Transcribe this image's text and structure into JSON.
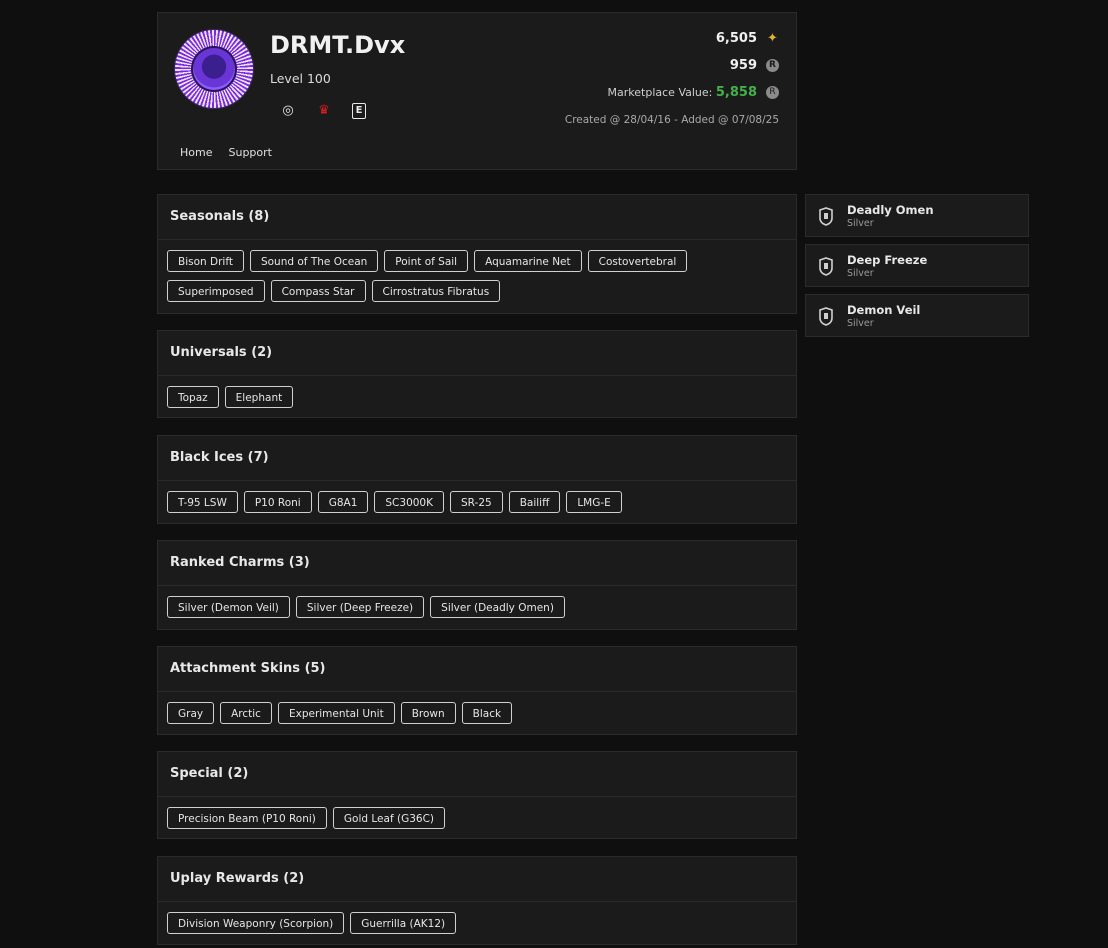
{
  "profile": {
    "name": "DRMT.Dvx",
    "level": "Level 100",
    "renown": "6,505",
    "credits": "959",
    "marketplace_label": "Marketplace Value:",
    "marketplace_value": "5,858",
    "created": "Created @ 28/04/16 - Added @ 07/08/25",
    "platforms": [
      "ubisoft-icon",
      "playstation-icon",
      "epic-icon"
    ]
  },
  "nav": {
    "home": "Home",
    "support": "Support"
  },
  "sections": [
    {
      "title": "Seasonals (8)",
      "items": [
        "Bison Drift",
        "Sound of The Ocean",
        "Point of Sail",
        "Aquamarine Net",
        "Costovertebral",
        "Superimposed",
        "Compass Star",
        "Cirrostratus Fibratus"
      ]
    },
    {
      "title": "Universals (2)",
      "items": [
        "Topaz",
        "Elephant"
      ]
    },
    {
      "title": "Black Ices (7)",
      "items": [
        "T-95 LSW",
        "P10 Roni",
        "G8A1",
        "SC3000K",
        "SR-25",
        "Bailiff",
        "LMG-E"
      ]
    },
    {
      "title": "Ranked Charms (3)",
      "items": [
        "Silver (Demon Veil)",
        "Silver (Deep Freeze)",
        "Silver (Deadly Omen)"
      ]
    },
    {
      "title": "Attachment Skins (5)",
      "items": [
        "Gray",
        "Arctic",
        "Experimental Unit",
        "Brown",
        "Black"
      ]
    },
    {
      "title": "Special (2)",
      "items": [
        "Precision Beam (P10 Roni)",
        "Gold Leaf (G36C)"
      ]
    },
    {
      "title": "Uplay Rewards (2)",
      "items": [
        "Division Weaponry (Scorpion)",
        "Guerrilla (AK12)"
      ]
    }
  ],
  "ranked": [
    {
      "name": "Deadly Omen",
      "tier": "Silver"
    },
    {
      "name": "Deep Freeze",
      "tier": "Silver"
    },
    {
      "name": "Demon Veil",
      "tier": "Silver"
    }
  ],
  "colors": {
    "background": "#0f0f0f",
    "card": "#1b1b1b",
    "market_value": "#43b14a",
    "renown": "#e3b32b"
  }
}
